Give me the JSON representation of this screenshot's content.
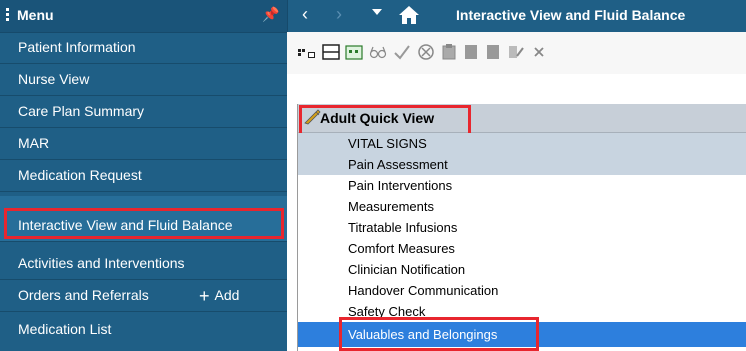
{
  "sidebar": {
    "title": "Menu",
    "pin_icon": "pin-icon",
    "items": [
      {
        "label": "Patient Information"
      },
      {
        "label": "Nurse View"
      },
      {
        "label": "Care Plan Summary"
      },
      {
        "label": "MAR"
      },
      {
        "label": "Medication Request"
      },
      {
        "label": "Interactive View and Fluid Balance"
      },
      {
        "label": "Activities and Interventions"
      },
      {
        "label": "Orders and Referrals"
      },
      {
        "label": "Medication List"
      }
    ],
    "add_label": "Add",
    "selected": "Interactive View and Fluid Balance"
  },
  "topbar": {
    "title": "Interactive View and Fluid Balance",
    "back": "‹",
    "forward": "›",
    "home": "⌂"
  },
  "toolbar": {
    "icons": [
      "grid-add-icon",
      "layout-icon",
      "calendar-icon",
      "glasses-icon",
      "checkmark-icon",
      "cancel-circle-icon",
      "clipboard-icon",
      "document-icon",
      "document-icon",
      "document-edit-icon",
      "close-icon"
    ]
  },
  "band": {
    "title": "Adult Quick View",
    "icon": "pencil-icon",
    "sections": [
      {
        "label": "VITAL SIGNS",
        "shaded": true
      },
      {
        "label": "Pain Assessment",
        "shaded": true
      },
      {
        "label": "Pain Interventions",
        "shaded": false
      },
      {
        "label": "Measurements",
        "shaded": false
      },
      {
        "label": "Titratable Infusions",
        "shaded": false
      },
      {
        "label": "Comfort Measures",
        "shaded": false
      },
      {
        "label": "Clinician Notification",
        "shaded": false
      },
      {
        "label": "Handover Communication",
        "shaded": false
      },
      {
        "label": "Safety Check",
        "shaded": false
      },
      {
        "label": "Valuables and Belongings",
        "selected": true
      }
    ]
  },
  "colors": {
    "sidebar_bg": "#1f5f86",
    "highlight_red": "#e8262e",
    "selected_row": "#2d7fdd",
    "band_header": "#c7cfd8"
  }
}
